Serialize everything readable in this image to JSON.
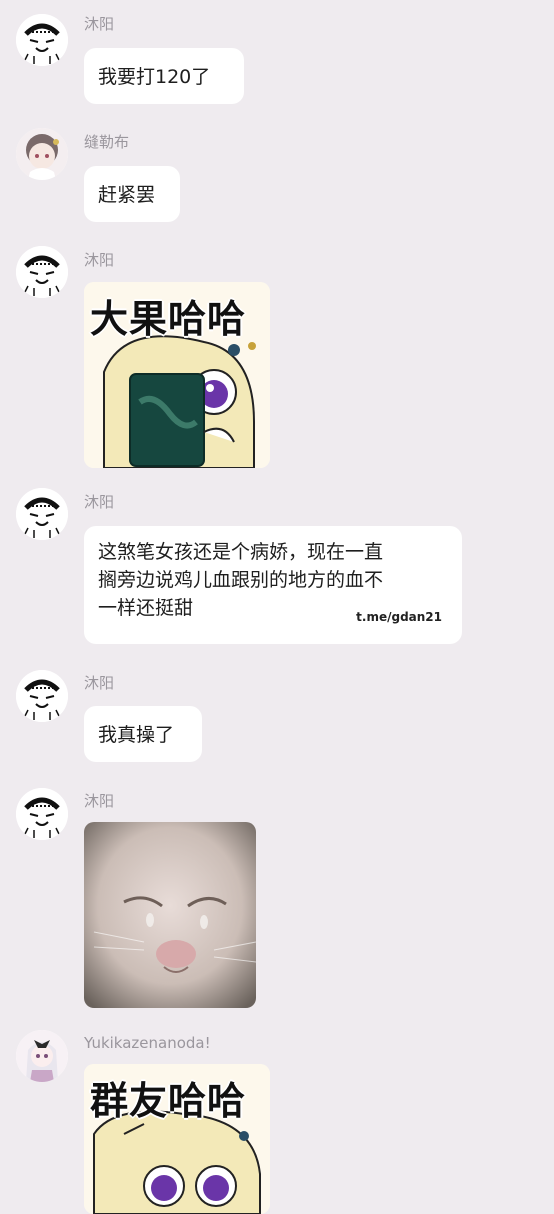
{
  "messages": [
    {
      "sender": "沐阳",
      "text": "我要打120了"
    },
    {
      "sender": "缝勒布",
      "text": "赶紧罢"
    },
    {
      "sender": "沐阳",
      "sticker_text": "大果哈哈",
      "sticker_icon": "anime-girl-holding-tea-pack-sticker"
    },
    {
      "sender": "沐阳",
      "lines": [
        "这煞笔女孩还是个病娇，现在一直",
        "搁旁边说鸡儿血跟别的地方的血不",
        "一样还挺甜"
      ],
      "watermark": "t.me/gdan21"
    },
    {
      "sender": "沐阳",
      "text": "我真操了"
    },
    {
      "sender": "沐阳",
      "photo_icon": "crying-cat-photo"
    },
    {
      "sender": "Yukikazenanoda!",
      "sticker_text": "群友哈哈",
      "sticker_icon": "anime-girl-sticker"
    }
  ],
  "colors": {
    "background": "#efebef",
    "bubble": "#ffffff",
    "sender_name": "#9a969d"
  }
}
